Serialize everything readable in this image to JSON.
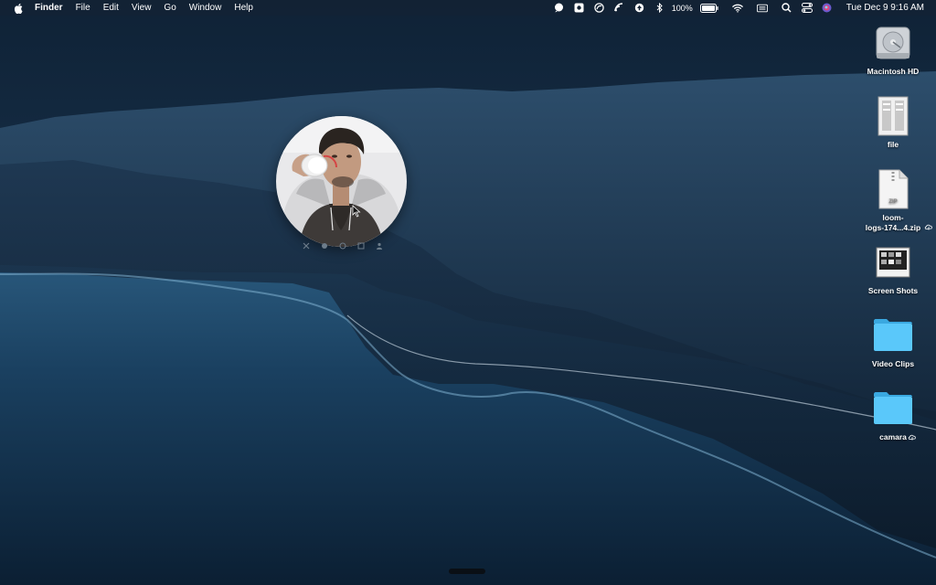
{
  "menubar": {
    "app_name": "Finder",
    "menus": [
      "File",
      "Edit",
      "View",
      "Go",
      "Window",
      "Help"
    ],
    "battery_percent": "100%",
    "clock": "Tue Dec 9  9:16 AM",
    "status_icons": [
      "chat-icon",
      "screen-icon",
      "loom-icon",
      "airplay-icon",
      "backup-icon",
      "bluetooth-icon",
      "battery-icon",
      "wifi-icon",
      "keyboard-icon",
      "search-icon",
      "control-center-icon",
      "siri-icon"
    ]
  },
  "desktop": {
    "icons": [
      {
        "label": "Macintosh HD",
        "icon": "hard-drive-icon"
      },
      {
        "label": "file",
        "icon": "document-icon"
      },
      {
        "label_line1": "loom-",
        "label_line2": "logs-174...4.zip",
        "icon": "zip-file-icon"
      },
      {
        "label": "Screen Shots",
        "icon": "screenshots-folder-icon"
      },
      {
        "label": "Video Clips",
        "icon": "folder-icon"
      },
      {
        "label": "camara",
        "icon": "folder-icon"
      }
    ]
  },
  "camera_bubble": {
    "controls": [
      "close-icon",
      "effects-icon",
      "record-icon",
      "resize-icon",
      "person-icon"
    ]
  },
  "colors": {
    "folder_blue": "#5ac8fa",
    "menubar_bg": "#142234"
  }
}
